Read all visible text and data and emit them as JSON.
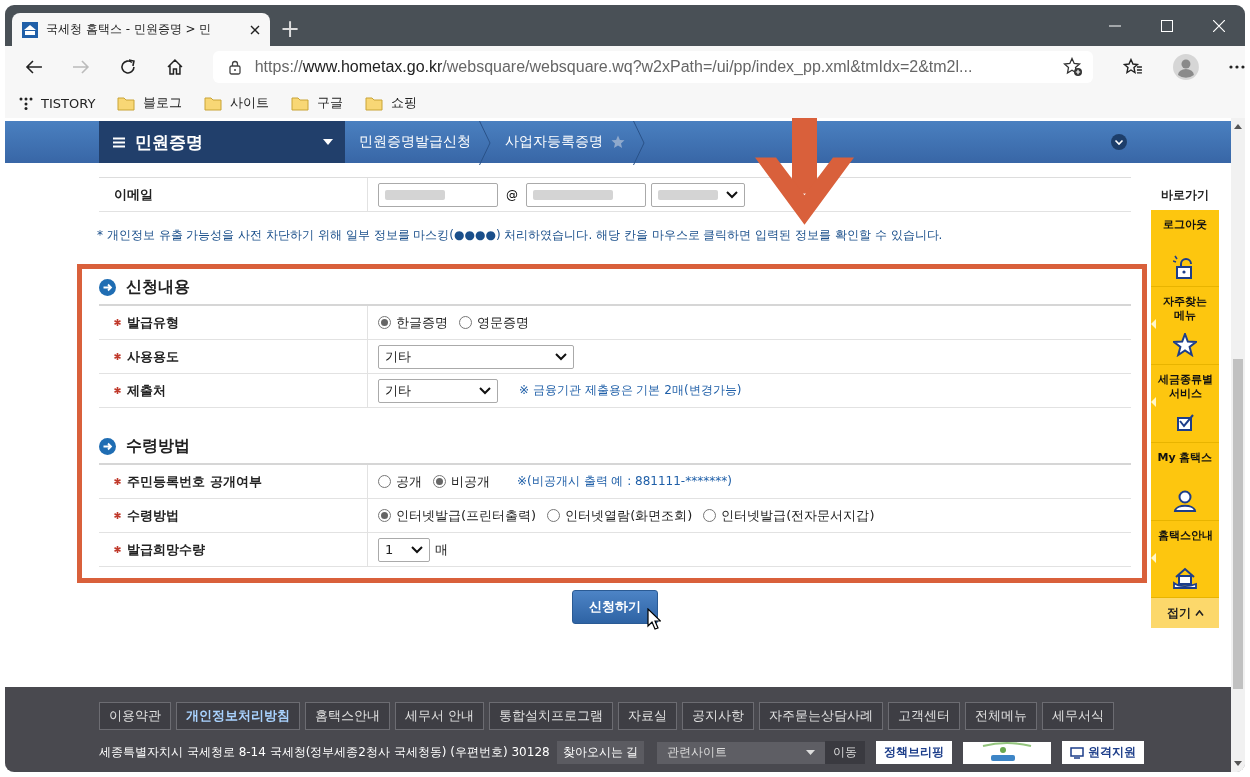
{
  "browser": {
    "tab_title": "국세청 홈택스 - 민원증명 > 민",
    "new_tab": "+",
    "forward_enabled": false,
    "url_scheme": "https://",
    "url_host": "www.hometax.go.kr",
    "url_path": "/websquare/websquare.wq?w2xPath=/ui/pp/index_pp.xml&tmIdx=2&tm2l...",
    "bookmarks": [
      {
        "label": "TISTORY",
        "kind": "site"
      },
      {
        "label": "블로그",
        "kind": "folder"
      },
      {
        "label": "사이트",
        "kind": "folder"
      },
      {
        "label": "구글",
        "kind": "folder"
      },
      {
        "label": "쇼핑",
        "kind": "folder"
      }
    ]
  },
  "nav_bar": {
    "menu": "민원증명",
    "breadcrumbs": [
      {
        "label": "민원증명발급신청"
      },
      {
        "label": "사업자등록증명",
        "starred": false
      }
    ]
  },
  "email": {
    "label": "이메일",
    "separator": "@"
  },
  "notice": "* 개인정보 유출 가능성을 사전 차단하기 위해 일부 정보를 마스킹(●●●●) 처리하였습니다. 해당 칸을 마우스로 클릭하면 입력된 정보를 확인할 수 있습니다.",
  "sections": [
    {
      "title": "신청내용",
      "rows": [
        {
          "label": "발급유형",
          "required": true,
          "kind": "radio",
          "options": [
            {
              "label": "한글증명",
              "selected": true
            },
            {
              "label": "영문증명",
              "selected": false
            }
          ]
        },
        {
          "label": "사용용도",
          "required": true,
          "kind": "dropdown-wide",
          "value": "기타"
        },
        {
          "label": "제출처",
          "required": true,
          "kind": "dropdown",
          "value": "기타",
          "note": "※ 금융기관 제출용은 기본 2매(변경가능)"
        }
      ]
    },
    {
      "title": "수령방법",
      "rows": [
        {
          "label": "주민등록번호 공개여부",
          "required": true,
          "kind": "radio",
          "options": [
            {
              "label": "공개",
              "selected": false
            },
            {
              "label": "비공개",
              "selected": true
            }
          ],
          "note": "※(비공개시 출력 예 : 881111-*******)"
        },
        {
          "label": "수령방법",
          "required": true,
          "kind": "radio",
          "options": [
            {
              "label": "인터넷발급(프린터출력)",
              "selected": true
            },
            {
              "label": "인터넷열람(화면조회)",
              "selected": false
            },
            {
              "label": "인터넷발급(전자문서지갑)",
              "selected": false
            }
          ]
        },
        {
          "label": "발급희망수량",
          "required": true,
          "kind": "dropdown-small",
          "value": "1",
          "suffix": "매"
        }
      ]
    }
  ],
  "submit": "신청하기",
  "quick_menu": {
    "title": "바로가기",
    "items": [
      {
        "label": "로그아웃",
        "submenu": false
      },
      {
        "label": "자주찾는 메뉴",
        "submenu": true
      },
      {
        "label": "세금종류별 서비스",
        "submenu": true
      },
      {
        "label": "My 홈택스",
        "submenu": false
      },
      {
        "label": "홈택스안내",
        "submenu": true
      }
    ],
    "collapse": "접기"
  },
  "footer": {
    "links": [
      {
        "label": "이용약관",
        "highlighted": false
      },
      {
        "label": "개인정보처리방침",
        "highlighted": true
      },
      {
        "label": "홈택스안내",
        "highlighted": false
      },
      {
        "label": "세무서 안내",
        "highlighted": false
      },
      {
        "label": "통합설치프로그램",
        "highlighted": false
      },
      {
        "label": "자료실",
        "highlighted": false
      },
      {
        "label": "공지사항",
        "highlighted": false
      },
      {
        "label": "자주묻는상담사례",
        "highlighted": false
      },
      {
        "label": "고객센터",
        "highlighted": false
      },
      {
        "label": "전체메뉴",
        "highlighted": false
      },
      {
        "label": "세무서식",
        "highlighted": false
      }
    ],
    "address": "세종특별자치시 국세청로 8-14 국세청(정부세종2청사 국세청동) (우편번호) 30128",
    "directions": "찾아오시는 길",
    "related_sites": "관련사이트",
    "go": "이동",
    "banners": [
      {
        "kind": "text",
        "label": "정책브리핑"
      },
      {
        "kind": "logo"
      },
      {
        "kind": "remote",
        "label": "원격지원"
      }
    ]
  }
}
